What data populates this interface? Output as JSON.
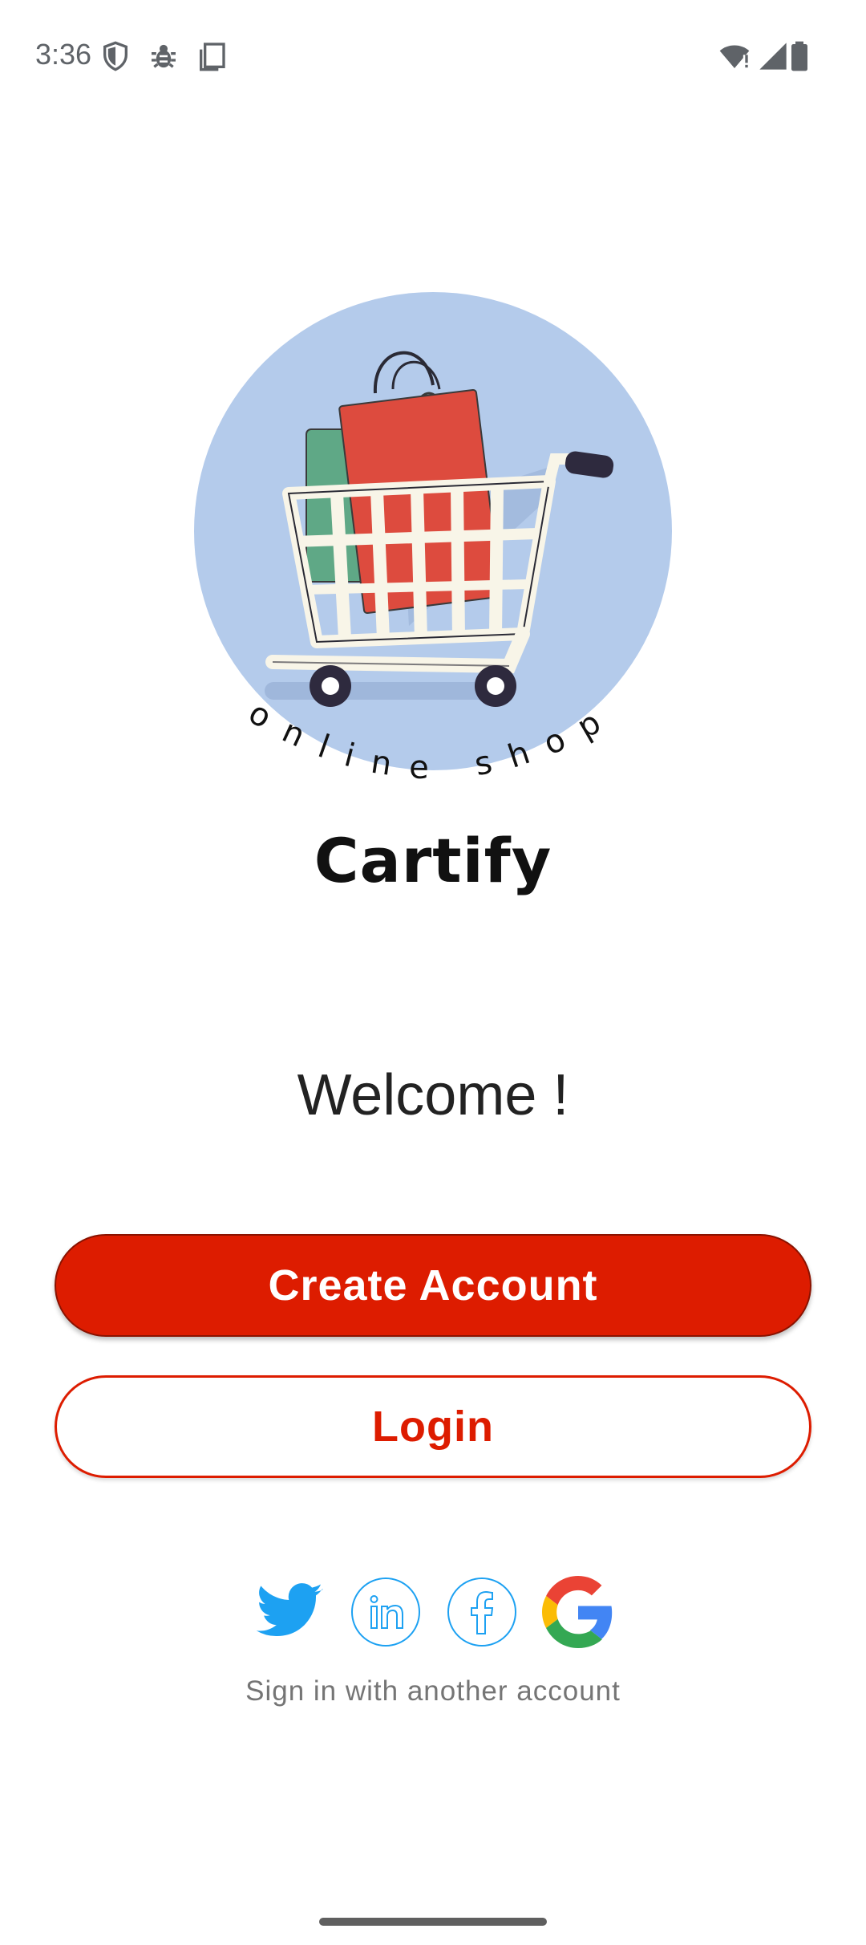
{
  "status_bar": {
    "time": "3:36",
    "left_icons": [
      "shield-icon",
      "bug-icon",
      "screenshot-icon"
    ],
    "right_icons": [
      "wifi-icon",
      "cellular-signal-icon",
      "battery-icon"
    ]
  },
  "logo": {
    "arc_text": "online shop",
    "brand": "Cartify",
    "circle_color": "#b4cbeb"
  },
  "welcome_text": "Welcome !",
  "buttons": {
    "create_account": "Create Account",
    "login": "Login"
  },
  "social": {
    "icons": [
      "twitter-icon",
      "linkedin-icon",
      "facebook-icon",
      "google-icon"
    ],
    "caption": "Sign in with another account"
  },
  "colors": {
    "primary": "#dd1c00",
    "social_outline": "#1da1f2"
  }
}
